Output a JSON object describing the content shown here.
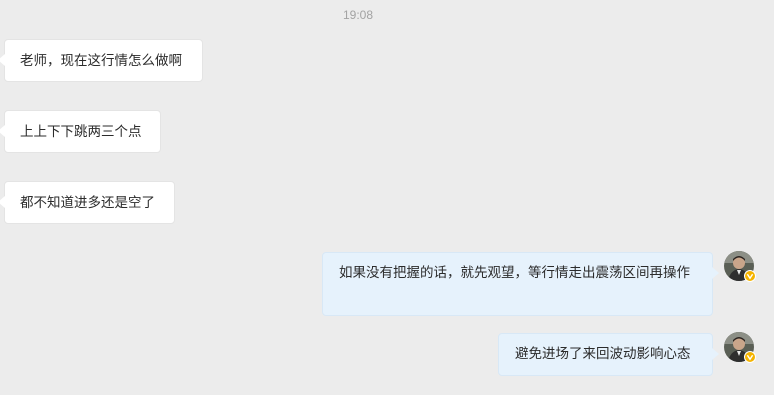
{
  "chat": {
    "timestamp": "19:08",
    "messages": [
      {
        "side": "left",
        "text": "老师，现在这行情怎么做啊"
      },
      {
        "side": "left",
        "text": "上上下下跳两三个点"
      },
      {
        "side": "left",
        "text": "都不知道进多还是空了"
      },
      {
        "side": "right",
        "text": "如果没有把握的话，就先观望，等行情走出震荡区间再操作"
      },
      {
        "side": "right",
        "text": "避免进场了来回波动影响心态"
      }
    ]
  },
  "avatar": {
    "icon": "user-avatar-with-verified-badge",
    "badge_color": "#f5b400"
  }
}
